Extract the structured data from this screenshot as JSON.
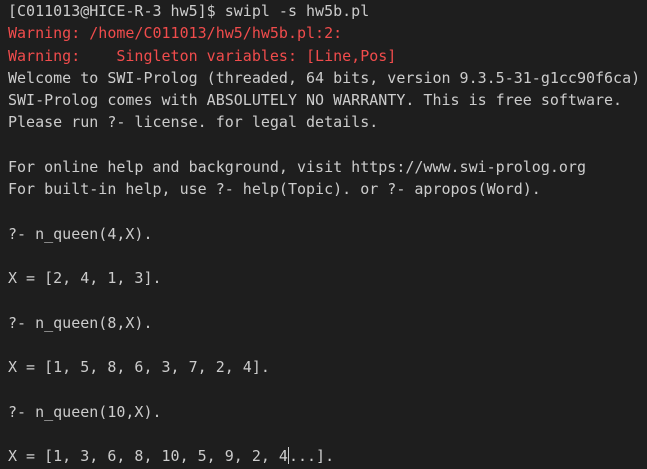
{
  "terminal": {
    "colors": {
      "background": "#1e1e1e",
      "foreground": "#cccccc",
      "warning": "#f14c4c"
    },
    "lines": [
      "[C011013@HICE-R-3 hw5]$ swipl -s hw5b.pl",
      "Warning: /home/C011013/hw5/hw5b.pl:2:",
      "Warning:    Singleton variables: [Line,Pos]",
      "Welcome to SWI-Prolog (threaded, 64 bits, version 9.3.5-31-g1cc90f6ca)",
      "SWI-Prolog comes with ABSOLUTELY NO WARRANTY. This is free software.",
      "Please run ?- license. for legal details.",
      "",
      "For online help and background, visit https://www.swi-prolog.org",
      "For built-in help, use ?- help(Topic). or ?- apropos(Word).",
      "",
      "?- n_queen(4,X).",
      "",
      "X = [2, 4, 1, 3].",
      "",
      "?- n_queen(8,X).",
      "",
      "X = [1, 5, 8, 6, 3, 7, 2, 4].",
      "",
      "?- n_queen(10,X).",
      "",
      "X = [1, 3, 6, 8, 10, 5, 9, 2, 4",
      "...]."
    ]
  }
}
